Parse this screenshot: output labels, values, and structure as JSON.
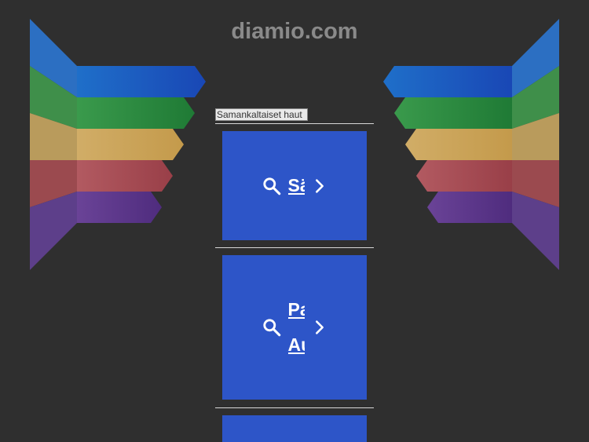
{
  "site": {
    "title": "diamio.com"
  },
  "related": {
    "label": "Samankaltaiset haut",
    "items": [
      {
        "links": [
          "Sähköpostit"
        ]
      },
      {
        "links": [
          "Palvelut",
          "Autot"
        ]
      },
      {
        "links": []
      }
    ]
  },
  "icons": {
    "search": "search-icon",
    "next": "chevron-right-icon"
  },
  "colors": {
    "background": "#2f2f2f",
    "card": "#2d55c8",
    "blue": "#2a78c8",
    "green": "#2f8a3e",
    "yellow": "#c9a35a",
    "red": "#a0474f",
    "purple": "#5a3a8a"
  }
}
